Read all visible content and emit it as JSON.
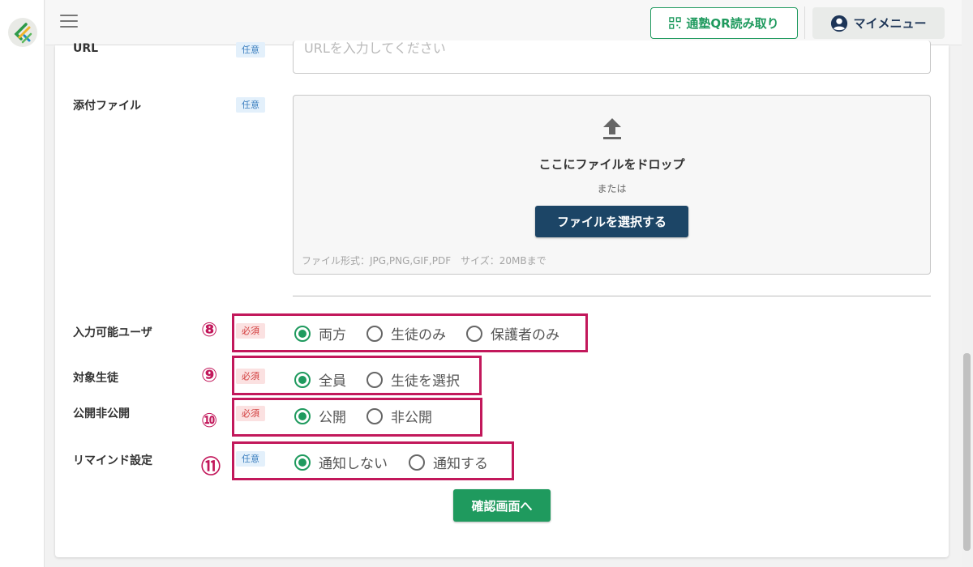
{
  "header": {
    "qr_button_label": "通塾QR読み取り",
    "my_menu_label": "マイメニュー"
  },
  "form": {
    "url": {
      "label": "URL",
      "badge": "任意",
      "placeholder": "URLを入力してください"
    },
    "attachment": {
      "label": "添付ファイル",
      "badge": "任意",
      "drop_title": "ここにファイルをドロップ",
      "or_text": "または",
      "select_button": "ファイルを選択する",
      "note": "ファイル形式：JPG,PNG,GIF,PDF　サイズ：20MBまで"
    },
    "input_user": {
      "marker": "⑧",
      "label": "入力可能ユーザ",
      "badge": "必須",
      "options": [
        "両方",
        "生徒のみ",
        "保護者のみ"
      ],
      "selected": "両方"
    },
    "target_student": {
      "marker": "⑨",
      "label": "対象生徒",
      "badge": "必須",
      "options": [
        "全員",
        "生徒を選択"
      ],
      "selected": "全員"
    },
    "visibility": {
      "marker": "⑩",
      "label": "公開非公開",
      "badge": "必須",
      "options": [
        "公開",
        "非公開"
      ],
      "selected": "公開"
    },
    "reminder": {
      "marker": "⑪",
      "label": "リマインド設定",
      "badge": "任意",
      "options": [
        "通知しない",
        "通知する"
      ],
      "selected": "通知しない"
    },
    "confirm_button": "確認画面へ"
  },
  "colors": {
    "accent_green": "#1f9a5e",
    "navy": "#1c4566",
    "highlight": "#c2185b",
    "badge_required": "#d23c3c",
    "badge_optional": "#3d7fbf"
  }
}
